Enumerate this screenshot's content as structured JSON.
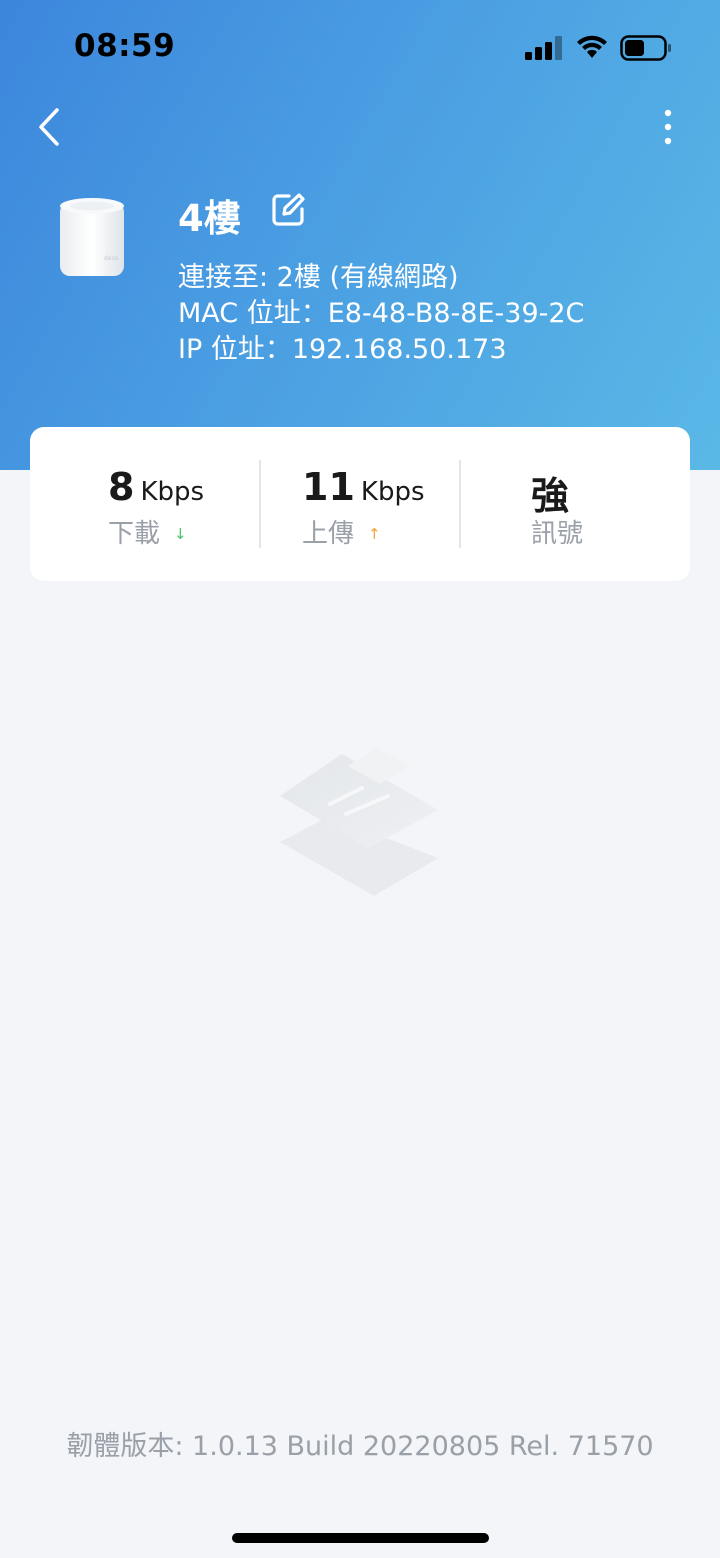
{
  "status_bar": {
    "time": "08:59"
  },
  "device": {
    "name": "4樓",
    "connected_to": "連接至: 2樓 (有線網路)",
    "mac": "MAC 位址：E8-48-B8-8E-39-2C",
    "ip": "IP 位址：192.168.50.173"
  },
  "stats": {
    "download": {
      "value": "8",
      "unit": "Kbps",
      "label": "下載",
      "arrow": "↓"
    },
    "upload": {
      "value": "11",
      "unit": "Kbps",
      "label": "上傳",
      "arrow": "↑"
    },
    "signal": {
      "value": "強",
      "label": "訊號"
    }
  },
  "footer": {
    "firmware": "韌體版本: 1.0.13 Build 20220805 Rel. 71570"
  },
  "colors": {
    "header_gradient_start": "#3c86dc",
    "header_gradient_end": "#5ab8e6",
    "download_arrow": "#48c46a",
    "upload_arrow": "#f2a53a",
    "background": "#f3f5f9"
  }
}
